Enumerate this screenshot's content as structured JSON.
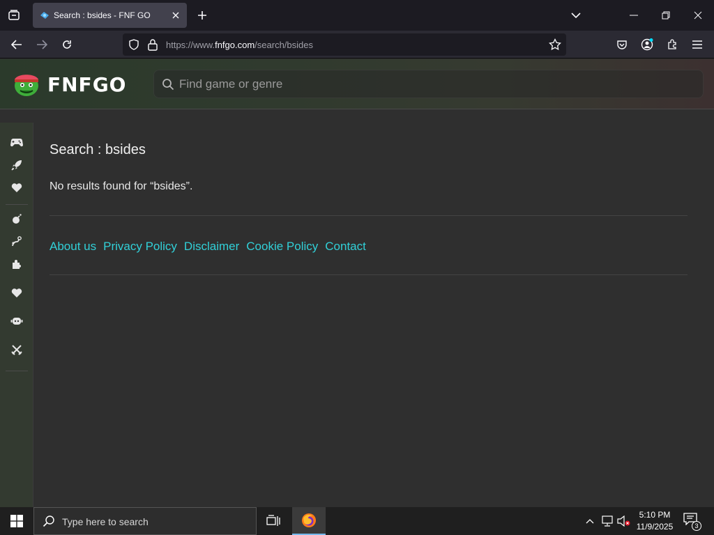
{
  "browser": {
    "tab_title": "Search : bsides - FNF GO",
    "url_prefix": "https://www.",
    "url_host": "fnfgo.com",
    "url_path": "/search/bsides"
  },
  "site": {
    "logo_text": "FNFGO",
    "search_placeholder": "Find game or genre"
  },
  "sidebar": {
    "items": [
      {
        "icon": "gamepad-icon"
      },
      {
        "icon": "rocket-icon"
      },
      {
        "icon": "heart-icon"
      },
      {
        "icon": "bomb-icon"
      },
      {
        "icon": "flask-icon"
      },
      {
        "icon": "puzzle-icon"
      },
      {
        "icon": "heart-icon"
      },
      {
        "icon": "robot-icon"
      },
      {
        "icon": "crossed-swords-icon"
      }
    ]
  },
  "main": {
    "title": "Search : bsides",
    "no_results": "No results found for “bsides”."
  },
  "footer": {
    "links": [
      "About us",
      "Privacy Policy",
      "Disclaimer",
      "Cookie Policy",
      "Contact"
    ]
  },
  "taskbar": {
    "search_placeholder": "Type here to search",
    "time": "5:10 PM",
    "date": "11/9/2025",
    "notification_count": "3"
  },
  "colors": {
    "accent_link": "#31d0d8",
    "background": "#2f2f2f"
  }
}
